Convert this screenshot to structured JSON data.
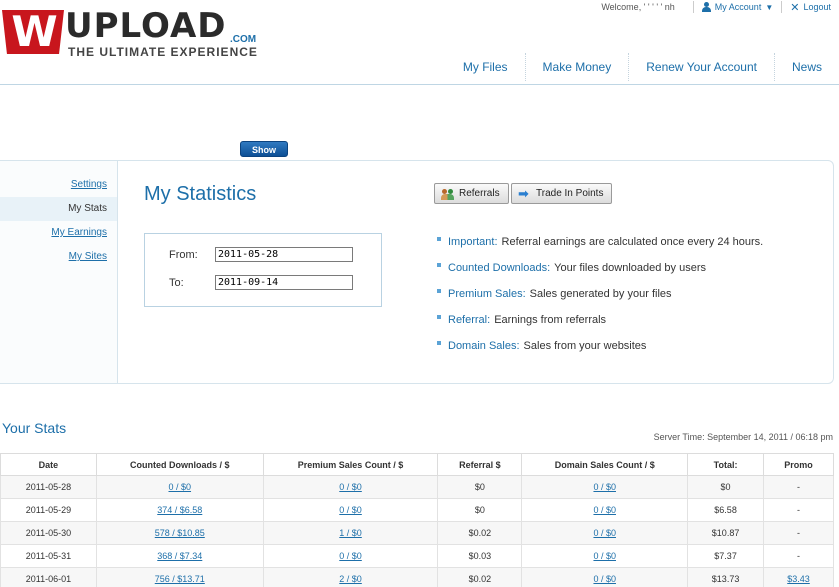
{
  "logo": {
    "letter": "W",
    "word": "UPLOAD",
    "tld": ".COM",
    "tagline": "THE ULTIMATE EXPERIENCE"
  },
  "topbar": {
    "welcome": "Welcome,  ' ' ' ' ' nh",
    "my_account": "My Account",
    "logout": "Logout"
  },
  "nav": [
    "My Files",
    "Make Money",
    "Renew Your Account",
    "News"
  ],
  "sidebar": [
    {
      "label": "Settings",
      "active": false
    },
    {
      "label": "My Stats",
      "active": true
    },
    {
      "label": "My Earnings",
      "active": false
    },
    {
      "label": "My Sites",
      "active": false
    }
  ],
  "page_title": "My Statistics",
  "date_form": {
    "from_label": "From:",
    "from_value": "2011-05-28",
    "to_label": "To:",
    "to_value": "2011-09-14",
    "show_button": "Show"
  },
  "buttons": {
    "referrals": "Referrals",
    "trade": "Trade In Points"
  },
  "info": [
    {
      "key": "Important:",
      "text": "Referral earnings are calculated once every 24 hours."
    },
    {
      "key": "Counted Downloads:",
      "text": "Your files downloaded by users"
    },
    {
      "key": "Premium Sales:",
      "text": "Sales generated by your files"
    },
    {
      "key": "Referral:",
      "text": "Earnings from referrals"
    },
    {
      "key": "Domain Sales:",
      "text": "Sales from your websites"
    }
  ],
  "stats": {
    "title": "Your Stats",
    "server_time": "Server Time: September 14, 2011 / 06:18 pm",
    "headers": [
      "Date",
      "Counted Downloads / $",
      "Premium Sales Count / $",
      "Referral $",
      "Domain Sales Count / $",
      "Total:",
      "Promo"
    ],
    "rows": [
      [
        "2011-05-28",
        "0 / $0",
        "0 / $0",
        "$0",
        "0 / $0",
        "$0",
        "-"
      ],
      [
        "2011-05-29",
        "374 / $6.58",
        "0 / $0",
        "$0",
        "0 / $0",
        "$6.58",
        "-"
      ],
      [
        "2011-05-30",
        "578 / $10.85",
        "1 / $0",
        "$0.02",
        "0 / $0",
        "$10.87",
        "-"
      ],
      [
        "2011-05-31",
        "368 / $7.34",
        "0 / $0",
        "$0.03",
        "0 / $0",
        "$7.37",
        "-"
      ],
      [
        "2011-06-01",
        "756 / $13.71",
        "2 / $0",
        "$0.02",
        "0 / $0",
        "$13.73",
        "$3.43"
      ]
    ]
  }
}
